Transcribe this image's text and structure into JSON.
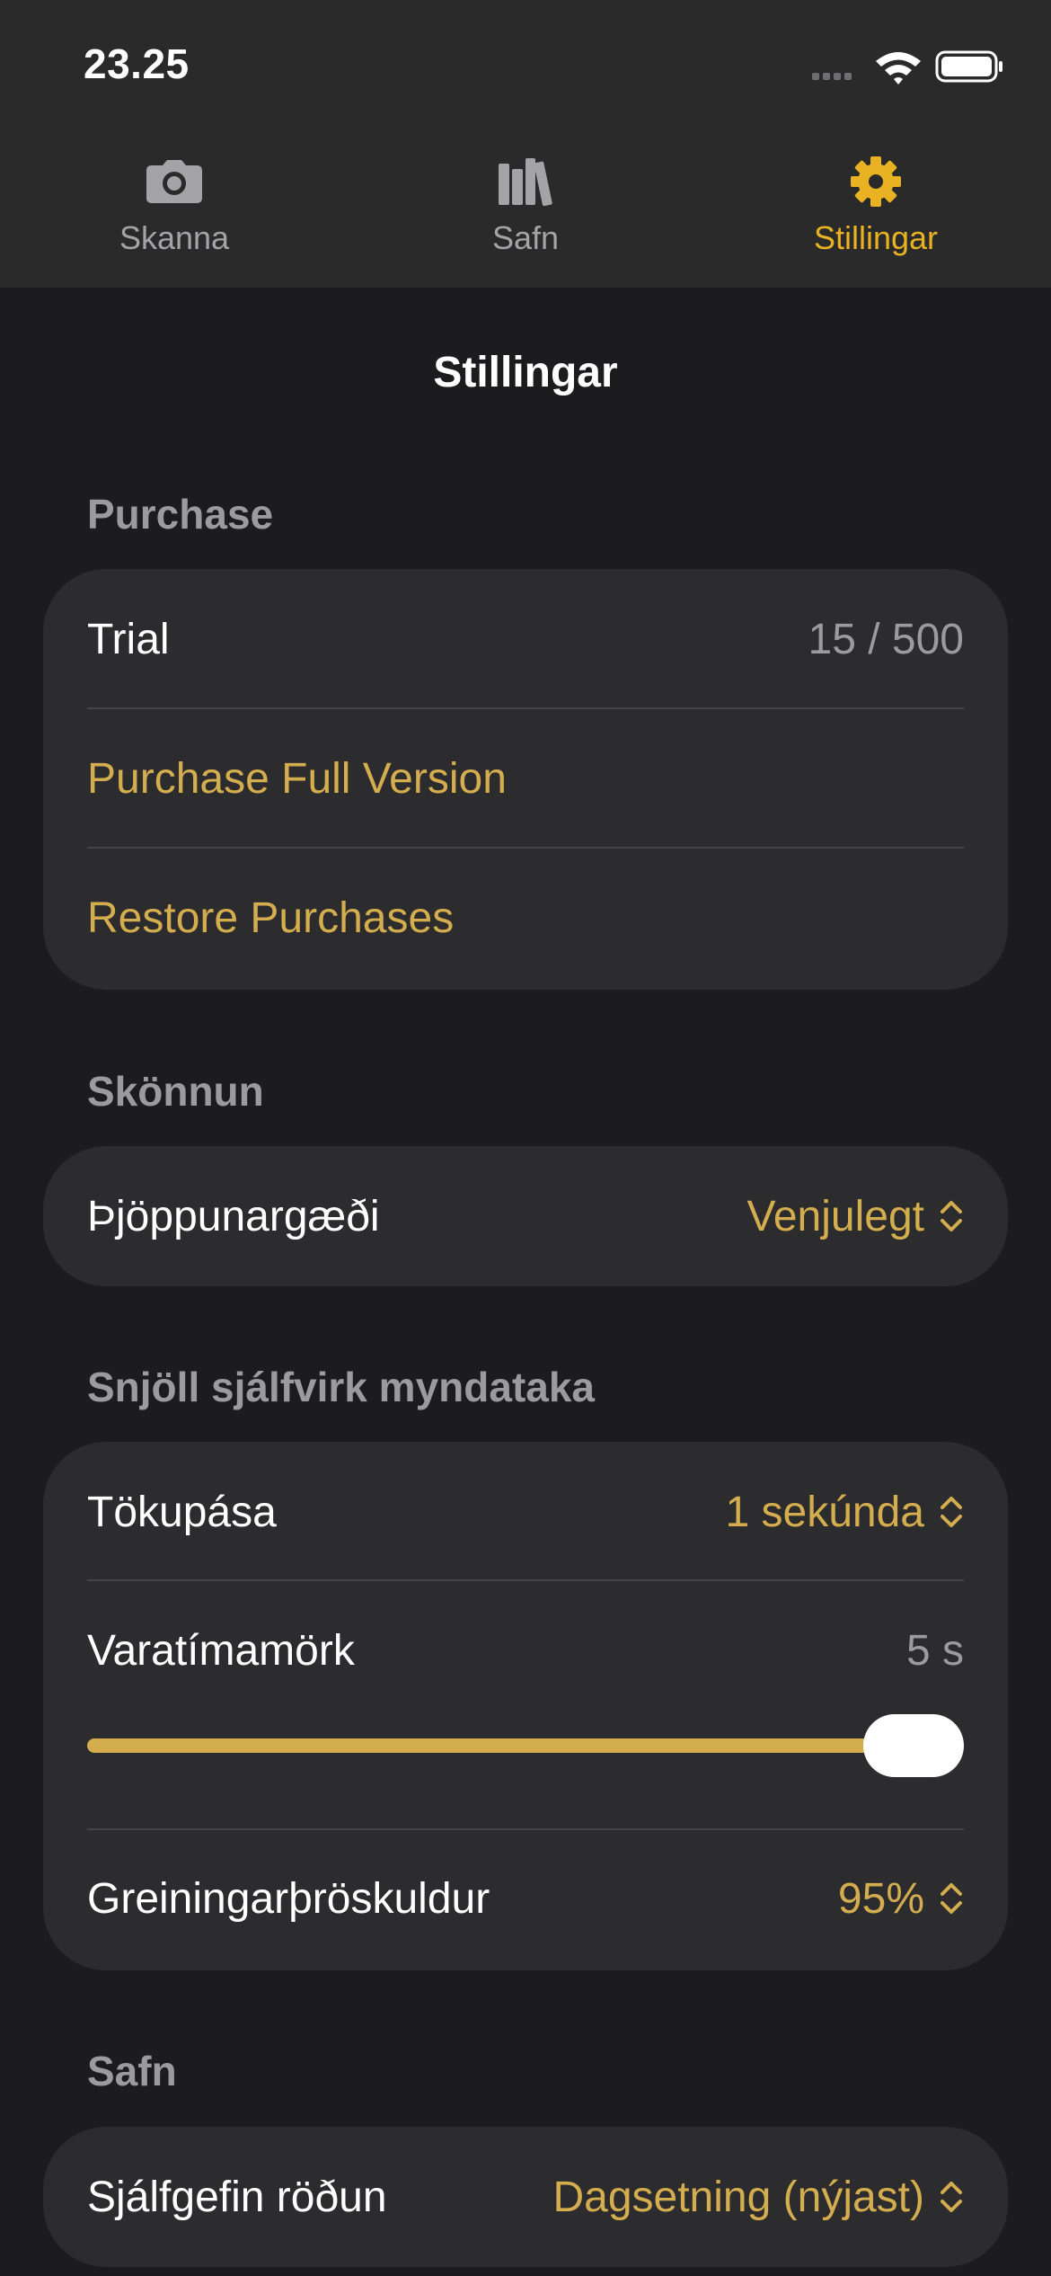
{
  "status_bar": {
    "time": "23.25"
  },
  "tabs": [
    {
      "label": "Skanna",
      "icon": "camera-icon",
      "active": false
    },
    {
      "label": "Safn",
      "icon": "library-icon",
      "active": false
    },
    {
      "label": "Stillingar",
      "icon": "gear-icon",
      "active": true
    }
  ],
  "page_title": "Stillingar",
  "colors": {
    "accent": "#d4ad4f",
    "tab_active": "#e9b223",
    "background": "#1c1c1e",
    "card": "#2c2c2e"
  },
  "sections": {
    "purchase": {
      "header": "Purchase",
      "trial_label": "Trial",
      "trial_value": "15 / 500",
      "purchase_full": "Purchase Full Version",
      "restore": "Restore Purchases"
    },
    "scanning": {
      "header": "Skönnun",
      "compression_label": "Þjöppunargæði",
      "compression_value": "Venjulegt"
    },
    "smart_capture": {
      "header": "Snjöll sjálfvirk myndataka",
      "pause_label": "Tökupása",
      "pause_value": "1 sekúnda",
      "timeout_label": "Varatímamörk",
      "timeout_value": "5 s",
      "timeout_slider_fraction": 1.0,
      "threshold_label": "Greiningarþröskuldur",
      "threshold_value": "95%"
    },
    "library": {
      "header": "Safn",
      "sort_label": "Sjálfgefin röðun",
      "sort_value": "Dagsetning (nýjast)"
    }
  }
}
